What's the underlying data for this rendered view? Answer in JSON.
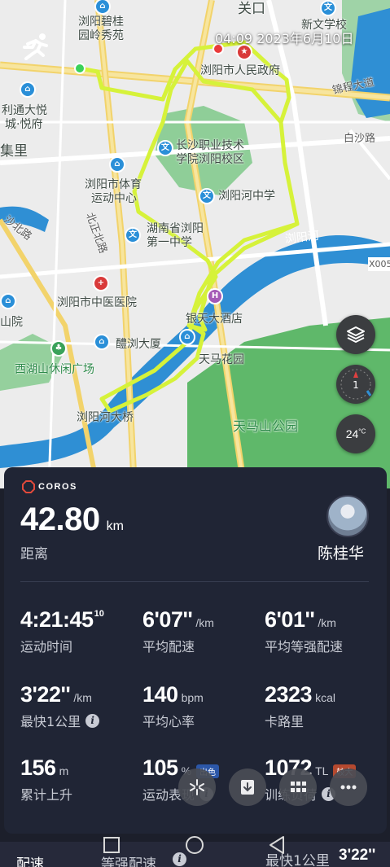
{
  "map": {
    "timestamp": "04:09 2023年6月10日",
    "labels": {
      "guankou": "关口",
      "xinwen_school": "新文学校",
      "liuyang_biguiyuan": "浏阳碧桂",
      "yuanling_xiuyuan": "园岭秀苑",
      "jinghui_road": "锦程大道",
      "city_gov": "浏阳市人民政府",
      "litong": "利通大悦",
      "chengyue": "城·悦府",
      "jili": "集里",
      "baisha_road": "白沙路",
      "vocational_1": "长沙职业技术",
      "vocational_2": "学院浏阳校区",
      "sports_1": "浏阳市体育",
      "sports_2": "运动中心",
      "liuyanghe_school": "浏阳河中学",
      "shahe_road": "沙北路",
      "beizheng_road": "北正北路",
      "hunan_1": "湖南省浏阳",
      "hunan_2": "第一中学",
      "liuyang_river": "浏阳河",
      "x005": "X005",
      "tcm_hospital": "浏阳市中医医院",
      "hotel": "银天大酒店",
      "shanyuan": "山院",
      "liling": "醴浏大厦",
      "tianma_garden": "天马花园",
      "xihu_park": "西湖山休闲广场",
      "bridge": "浏阳河大桥",
      "tianma_park": "天马山公园"
    },
    "temperature": "24",
    "temperature_unit": "°C",
    "compass_value": "1"
  },
  "card": {
    "brand": "COROS",
    "distance_value": "42.80",
    "distance_unit": "km",
    "distance_label": "距离",
    "user_name": "陈桂华",
    "stats": [
      {
        "value": "4:21:45",
        "sup": "10",
        "unit": "",
        "label": "运动时间"
      },
      {
        "value": "6'07''",
        "unit": "/km",
        "label": "平均配速"
      },
      {
        "value": "6'01''",
        "unit": "/km",
        "label": "平均等强配速"
      },
      {
        "value": "3'22''",
        "unit": "/km",
        "label": "最快1公里"
      },
      {
        "value": "140",
        "unit": "bpm",
        "label": "平均心率"
      },
      {
        "value": "2323",
        "unit": "kcal",
        "label": "卡路里"
      },
      {
        "value": "156",
        "unit": "m",
        "label": "累计上升"
      },
      {
        "value": "105",
        "unit": "%",
        "label": "运动表现",
        "tag": "出色"
      },
      {
        "value": "1072",
        "unit": "TL",
        "label": "训练负荷",
        "tag": "较大"
      }
    ]
  },
  "bottom_sheet": {
    "tab_pace": "配速",
    "tab_equal_pace": "等强配速",
    "fastest_label": "最快1公里",
    "fastest_value": "3'22''"
  },
  "colors": {
    "track": "#d6f23a",
    "card_bg": "#202535",
    "water": "#2f8fd4",
    "park": "#5fb86a"
  }
}
